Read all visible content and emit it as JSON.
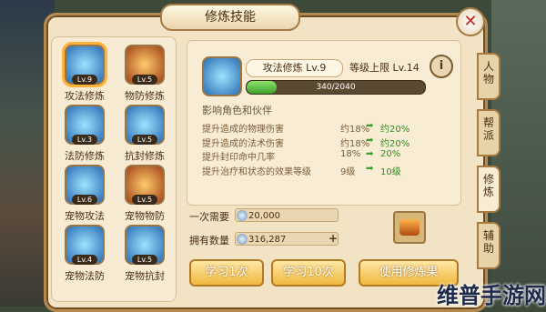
{
  "window": {
    "title": "修炼技能",
    "close": "✕"
  },
  "skills": [
    {
      "label": "攻法修炼",
      "lv": "Lv.9",
      "icon": "attack-magic-icon",
      "selected": true
    },
    {
      "label": "物防修炼",
      "lv": "Lv.5",
      "icon": "physical-defense-icon"
    },
    {
      "label": "法防修炼",
      "lv": "Lv.3",
      "icon": "magic-defense-icon"
    },
    {
      "label": "抗封修炼",
      "lv": "Lv.5",
      "icon": "seal-resist-icon"
    },
    {
      "label": "宠物攻法",
      "lv": "Lv.6",
      "icon": "pet-attack-icon"
    },
    {
      "label": "宠物物防",
      "lv": "Lv.5",
      "icon": "pet-defense-icon"
    },
    {
      "label": "宠物法防",
      "lv": "Lv.4",
      "icon": "pet-magic-defense-icon"
    },
    {
      "label": "宠物抗封",
      "lv": "Lv.5",
      "icon": "pet-seal-resist-icon"
    }
  ],
  "detail": {
    "name": "攻法修炼",
    "level": "Lv.9",
    "cap_label": "等级上限",
    "cap_value": "Lv.14",
    "progress_text": "340/2040",
    "progress_fraction": 0.167,
    "affect_title": "影响角色和伙伴",
    "effects": [
      {
        "text": "提升造成的物理伤害",
        "from": "约18%",
        "to": "约20%"
      },
      {
        "text": "提升造成的法术伤害",
        "from": "约18%",
        "to": "约20%"
      },
      {
        "text": "提升封印命中几率",
        "from": "18%",
        "to": "20%"
      },
      {
        "text": "提升治疗和状态的效果等级",
        "from": "9级",
        "to": "10级"
      }
    ]
  },
  "cost": {
    "need_label": "一次需要",
    "need_value": "20,000",
    "have_label": "拥有数量",
    "have_value": "316,287"
  },
  "buttons": {
    "learn1": "学习1次",
    "learn10": "学习10次",
    "use_item": "使用修炼果"
  },
  "side_tabs": [
    {
      "label": "人物"
    },
    {
      "label": "帮派"
    },
    {
      "label": "修炼",
      "active": true
    },
    {
      "label": "辅助"
    }
  ],
  "watermark": "维普手游网"
}
